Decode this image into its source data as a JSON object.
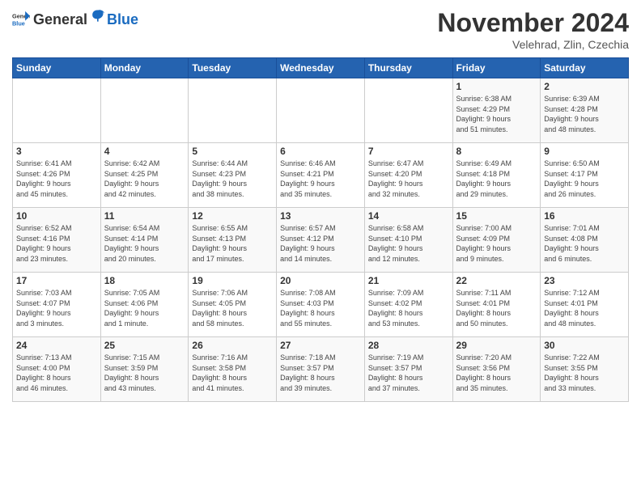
{
  "header": {
    "logo_general": "General",
    "logo_blue": "Blue",
    "title": "November 2024",
    "location": "Velehrad, Zlin, Czechia"
  },
  "days_of_week": [
    "Sunday",
    "Monday",
    "Tuesday",
    "Wednesday",
    "Thursday",
    "Friday",
    "Saturday"
  ],
  "weeks": [
    [
      {
        "day": "",
        "info": ""
      },
      {
        "day": "",
        "info": ""
      },
      {
        "day": "",
        "info": ""
      },
      {
        "day": "",
        "info": ""
      },
      {
        "day": "",
        "info": ""
      },
      {
        "day": "1",
        "info": "Sunrise: 6:38 AM\nSunset: 4:29 PM\nDaylight: 9 hours\nand 51 minutes."
      },
      {
        "day": "2",
        "info": "Sunrise: 6:39 AM\nSunset: 4:28 PM\nDaylight: 9 hours\nand 48 minutes."
      }
    ],
    [
      {
        "day": "3",
        "info": "Sunrise: 6:41 AM\nSunset: 4:26 PM\nDaylight: 9 hours\nand 45 minutes."
      },
      {
        "day": "4",
        "info": "Sunrise: 6:42 AM\nSunset: 4:25 PM\nDaylight: 9 hours\nand 42 minutes."
      },
      {
        "day": "5",
        "info": "Sunrise: 6:44 AM\nSunset: 4:23 PM\nDaylight: 9 hours\nand 38 minutes."
      },
      {
        "day": "6",
        "info": "Sunrise: 6:46 AM\nSunset: 4:21 PM\nDaylight: 9 hours\nand 35 minutes."
      },
      {
        "day": "7",
        "info": "Sunrise: 6:47 AM\nSunset: 4:20 PM\nDaylight: 9 hours\nand 32 minutes."
      },
      {
        "day": "8",
        "info": "Sunrise: 6:49 AM\nSunset: 4:18 PM\nDaylight: 9 hours\nand 29 minutes."
      },
      {
        "day": "9",
        "info": "Sunrise: 6:50 AM\nSunset: 4:17 PM\nDaylight: 9 hours\nand 26 minutes."
      }
    ],
    [
      {
        "day": "10",
        "info": "Sunrise: 6:52 AM\nSunset: 4:16 PM\nDaylight: 9 hours\nand 23 minutes."
      },
      {
        "day": "11",
        "info": "Sunrise: 6:54 AM\nSunset: 4:14 PM\nDaylight: 9 hours\nand 20 minutes."
      },
      {
        "day": "12",
        "info": "Sunrise: 6:55 AM\nSunset: 4:13 PM\nDaylight: 9 hours\nand 17 minutes."
      },
      {
        "day": "13",
        "info": "Sunrise: 6:57 AM\nSunset: 4:12 PM\nDaylight: 9 hours\nand 14 minutes."
      },
      {
        "day": "14",
        "info": "Sunrise: 6:58 AM\nSunset: 4:10 PM\nDaylight: 9 hours\nand 12 minutes."
      },
      {
        "day": "15",
        "info": "Sunrise: 7:00 AM\nSunset: 4:09 PM\nDaylight: 9 hours\nand 9 minutes."
      },
      {
        "day": "16",
        "info": "Sunrise: 7:01 AM\nSunset: 4:08 PM\nDaylight: 9 hours\nand 6 minutes."
      }
    ],
    [
      {
        "day": "17",
        "info": "Sunrise: 7:03 AM\nSunset: 4:07 PM\nDaylight: 9 hours\nand 3 minutes."
      },
      {
        "day": "18",
        "info": "Sunrise: 7:05 AM\nSunset: 4:06 PM\nDaylight: 9 hours\nand 1 minute."
      },
      {
        "day": "19",
        "info": "Sunrise: 7:06 AM\nSunset: 4:05 PM\nDaylight: 8 hours\nand 58 minutes."
      },
      {
        "day": "20",
        "info": "Sunrise: 7:08 AM\nSunset: 4:03 PM\nDaylight: 8 hours\nand 55 minutes."
      },
      {
        "day": "21",
        "info": "Sunrise: 7:09 AM\nSunset: 4:02 PM\nDaylight: 8 hours\nand 53 minutes."
      },
      {
        "day": "22",
        "info": "Sunrise: 7:11 AM\nSunset: 4:01 PM\nDaylight: 8 hours\nand 50 minutes."
      },
      {
        "day": "23",
        "info": "Sunrise: 7:12 AM\nSunset: 4:01 PM\nDaylight: 8 hours\nand 48 minutes."
      }
    ],
    [
      {
        "day": "24",
        "info": "Sunrise: 7:13 AM\nSunset: 4:00 PM\nDaylight: 8 hours\nand 46 minutes."
      },
      {
        "day": "25",
        "info": "Sunrise: 7:15 AM\nSunset: 3:59 PM\nDaylight: 8 hours\nand 43 minutes."
      },
      {
        "day": "26",
        "info": "Sunrise: 7:16 AM\nSunset: 3:58 PM\nDaylight: 8 hours\nand 41 minutes."
      },
      {
        "day": "27",
        "info": "Sunrise: 7:18 AM\nSunset: 3:57 PM\nDaylight: 8 hours\nand 39 minutes."
      },
      {
        "day": "28",
        "info": "Sunrise: 7:19 AM\nSunset: 3:57 PM\nDaylight: 8 hours\nand 37 minutes."
      },
      {
        "day": "29",
        "info": "Sunrise: 7:20 AM\nSunset: 3:56 PM\nDaylight: 8 hours\nand 35 minutes."
      },
      {
        "day": "30",
        "info": "Sunrise: 7:22 AM\nSunset: 3:55 PM\nDaylight: 8 hours\nand 33 minutes."
      }
    ]
  ]
}
